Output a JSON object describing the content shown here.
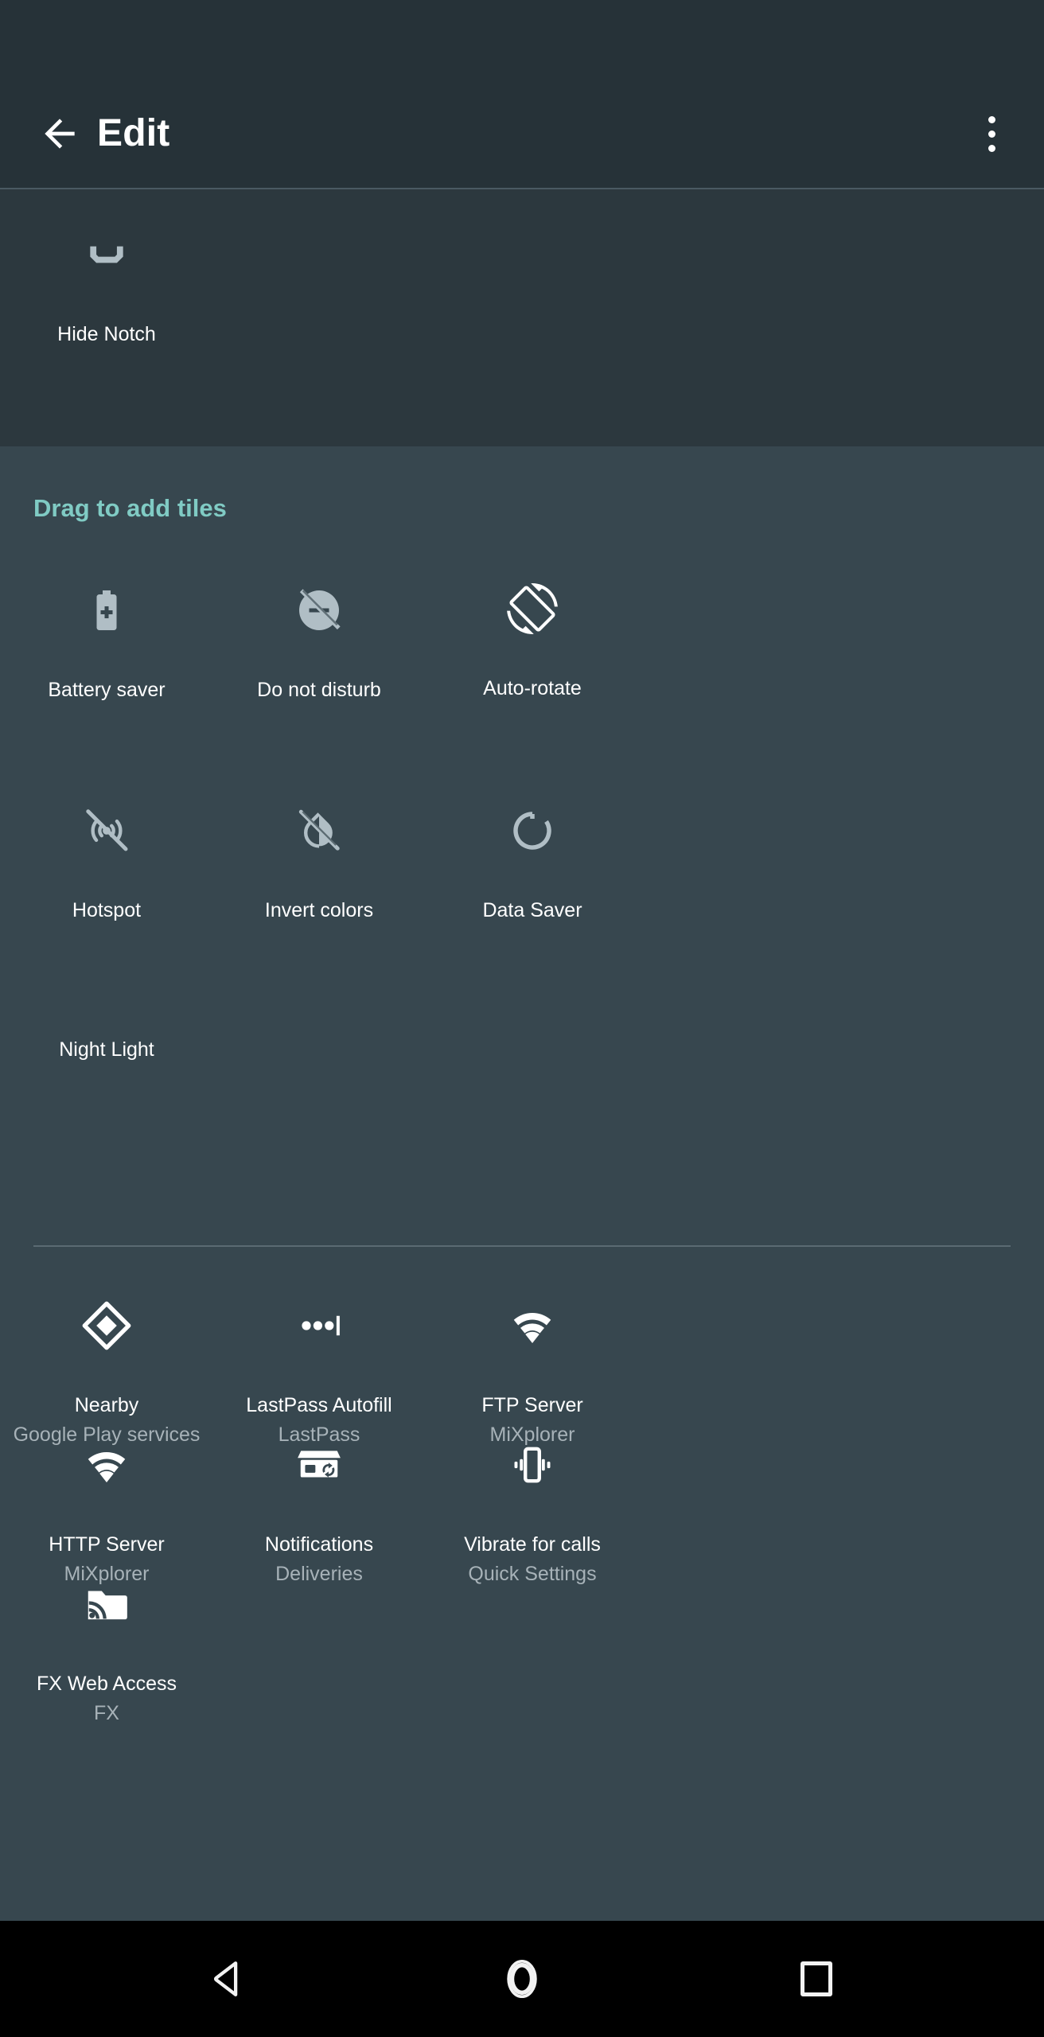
{
  "appbar": {
    "back_icon": "arrow-left-icon",
    "title": "Edit",
    "overflow_icon": "more-vertical-icon"
  },
  "current_tiles": {
    "items": [
      {
        "label": "Hide Notch",
        "icon": "notch-icon"
      }
    ]
  },
  "add_section": {
    "header": "Drag to add tiles",
    "system_tiles": [
      {
        "label": "Battery saver",
        "icon": "battery-plus-icon"
      },
      {
        "label": "Do not disturb",
        "icon": "do-not-disturb-icon"
      },
      {
        "label": "Auto-rotate",
        "icon": "screen-rotation-icon"
      },
      {
        "label": "Hotspot",
        "icon": "hotspot-off-icon"
      },
      {
        "label": "Invert colors",
        "icon": "invert-colors-off-icon"
      },
      {
        "label": "Data Saver",
        "icon": "data-saver-icon"
      },
      {
        "label": "Night Light",
        "icon": "moon-icon"
      }
    ],
    "app_tiles": [
      {
        "label": "Nearby",
        "sublabel": "Google Play services",
        "icon": "nearby-diamond-icon"
      },
      {
        "label": "LastPass Autofill",
        "sublabel": "LastPass",
        "icon": "autofill-dots-icon"
      },
      {
        "label": "FTP Server",
        "sublabel": "MiXplorer",
        "icon": "wifi-icon"
      },
      {
        "label": "HTTP Server",
        "sublabel": "MiXplorer",
        "icon": "wifi-icon"
      },
      {
        "label": "Notifications",
        "sublabel": "Deliveries",
        "icon": "package-sync-icon"
      },
      {
        "label": "Vibrate for calls",
        "sublabel": "Quick Settings",
        "icon": "vibration-icon"
      },
      {
        "label": "FX Web Access",
        "sublabel": "FX",
        "icon": "folder-broadcast-icon"
      }
    ]
  },
  "navbar": {
    "back": "nav-back-icon",
    "home": "nav-home-icon",
    "recents": "nav-recents-icon"
  },
  "colors": {
    "appbar_bg": "#263238",
    "current_panel_bg": "#2c383e",
    "content_bg": "#37474f",
    "accent": "#80cbc4",
    "icon_dim": "#b0bec5",
    "icon_bright": "#ffffff",
    "sublabel": "#a7b2b8",
    "navbar_bg": "#000000"
  }
}
